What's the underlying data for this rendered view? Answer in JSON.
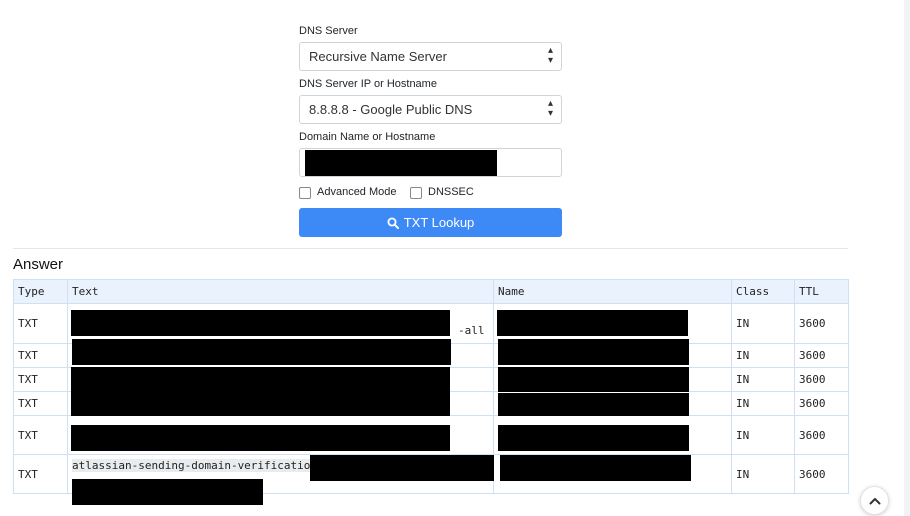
{
  "form": {
    "dns_server_label": "DNS Server",
    "dns_server_value": "Recursive Name Server",
    "dns_ip_label": "DNS Server IP or Hostname",
    "dns_ip_value": "8.8.8.8 - Google Public DNS",
    "domain_label": "Domain Name or Hostname",
    "domain_value": "",
    "advanced_mode_label": "Advanced Mode",
    "dnssec_label": "DNSSEC",
    "lookup_button_label": "TXT Lookup"
  },
  "answer": {
    "title": "Answer",
    "columns": [
      "Type",
      "Text",
      "Name",
      "Class",
      "TTL"
    ],
    "rows": [
      {
        "type": "TXT",
        "text": "-all",
        "class": "IN",
        "ttl": "3600"
      },
      {
        "type": "TXT",
        "text": "",
        "class": "IN",
        "ttl": "3600"
      },
      {
        "type": "TXT",
        "text": "",
        "class": "IN",
        "ttl": "3600"
      },
      {
        "type": "TXT",
        "text": "",
        "class": "IN",
        "ttl": "3600"
      },
      {
        "type": "TXT",
        "text": "",
        "class": "IN",
        "ttl": "3600"
      },
      {
        "type": "TXT",
        "text": "atlassian-sending-domain-verification=",
        "class": "IN",
        "ttl": "3600"
      }
    ]
  },
  "icons": {
    "select_caret": "updown-caret-icon",
    "lookup": "search-icon",
    "scroll_top": "chevron-up-icon"
  },
  "colors": {
    "button": "#3d8af7",
    "table_header_bg": "#eaf3fd",
    "table_border": "#cfe0f3",
    "redaction": "#000000"
  }
}
